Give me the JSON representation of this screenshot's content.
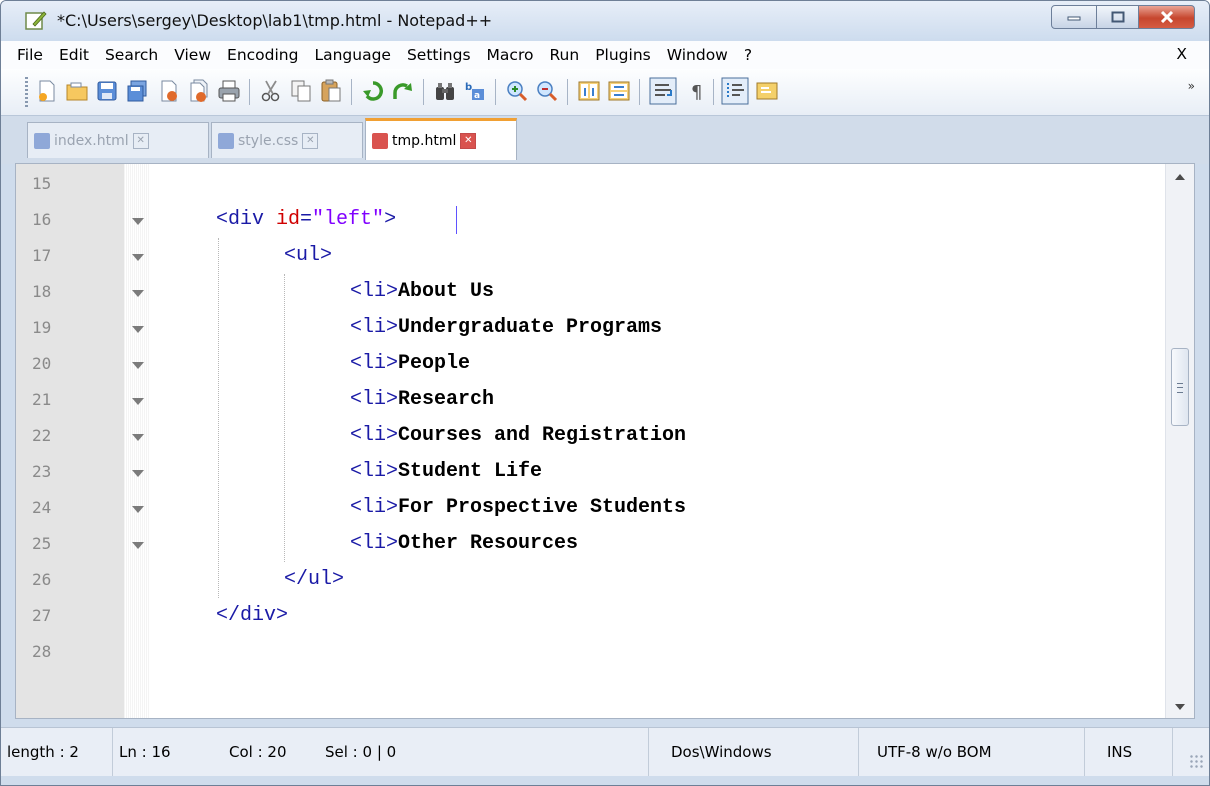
{
  "window": {
    "title": "*C:\\Users\\sergey\\Desktop\\lab1\\tmp.html - Notepad++"
  },
  "menu": {
    "items": [
      "File",
      "Edit",
      "Search",
      "View",
      "Encoding",
      "Language",
      "Settings",
      "Macro",
      "Run",
      "Plugins",
      "Window",
      "?"
    ],
    "close_label": "X"
  },
  "toolbar": {
    "icons": [
      "new-file-icon",
      "open-file-icon",
      "save-icon",
      "save-all-icon",
      "close-icon",
      "close-all-icon",
      "print-icon",
      "cut-icon",
      "copy-icon",
      "paste-icon",
      "undo-icon",
      "redo-icon",
      "find-icon",
      "replace-icon",
      "zoom-in-icon",
      "zoom-out-icon",
      "sync-vertical-icon",
      "sync-horizontal-icon",
      "word-wrap-icon",
      "show-all-chars-icon",
      "indent-guide-icon",
      "doc-map-icon"
    ]
  },
  "tabs": [
    {
      "label": "index.html",
      "active": false,
      "icon_color": "#8fa8d8"
    },
    {
      "label": "style.css",
      "active": false,
      "icon_color": "#8fa8d8"
    },
    {
      "label": "tmp.html",
      "active": true,
      "icon_color": "#d9534f"
    }
  ],
  "editor": {
    "lines": [
      {
        "num": "15",
        "fold": false,
        "indent": 0,
        "tag_open": "",
        "attr": "",
        "eq": "",
        "str": "",
        "tag_close": "",
        "text": ""
      },
      {
        "num": "16",
        "fold": true,
        "indent": 1,
        "tag_open": "<div",
        "attr": " id",
        "eq": "=",
        "str": "\"left\"",
        "tag_close": ">",
        "text": ""
      },
      {
        "num": "17",
        "fold": true,
        "indent": 2,
        "tag_open": "<ul>",
        "attr": "",
        "eq": "",
        "str": "",
        "tag_close": "",
        "text": ""
      },
      {
        "num": "18",
        "fold": true,
        "indent": 3,
        "tag_open": "<li>",
        "attr": "",
        "eq": "",
        "str": "",
        "tag_close": "",
        "text": "About Us"
      },
      {
        "num": "19",
        "fold": true,
        "indent": 3,
        "tag_open": "<li>",
        "attr": "",
        "eq": "",
        "str": "",
        "tag_close": "",
        "text": "Undergraduate Programs"
      },
      {
        "num": "20",
        "fold": true,
        "indent": 3,
        "tag_open": "<li>",
        "attr": "",
        "eq": "",
        "str": "",
        "tag_close": "",
        "text": "People"
      },
      {
        "num": "21",
        "fold": true,
        "indent": 3,
        "tag_open": "<li>",
        "attr": "",
        "eq": "",
        "str": "",
        "tag_close": "",
        "text": "Research"
      },
      {
        "num": "22",
        "fold": true,
        "indent": 3,
        "tag_open": "<li>",
        "attr": "",
        "eq": "",
        "str": "",
        "tag_close": "",
        "text": "Courses and Registration"
      },
      {
        "num": "23",
        "fold": true,
        "indent": 3,
        "tag_open": "<li>",
        "attr": "",
        "eq": "",
        "str": "",
        "tag_close": "",
        "text": "Student Life"
      },
      {
        "num": "24",
        "fold": true,
        "indent": 3,
        "tag_open": "<li>",
        "attr": "",
        "eq": "",
        "str": "",
        "tag_close": "",
        "text": "For Prospective Students"
      },
      {
        "num": "25",
        "fold": true,
        "indent": 3,
        "tag_open": "<li>",
        "attr": "",
        "eq": "",
        "str": "",
        "tag_close": "",
        "text": "Other Resources"
      },
      {
        "num": "26",
        "fold": false,
        "indent": 2,
        "tag_open": "</ul>",
        "attr": "",
        "eq": "",
        "str": "",
        "tag_close": "",
        "text": ""
      },
      {
        "num": "27",
        "fold": false,
        "indent": 1,
        "tag_open": "</div>",
        "attr": "",
        "eq": "",
        "str": "",
        "tag_close": "",
        "text": ""
      },
      {
        "num": "28",
        "fold": false,
        "indent": 0,
        "tag_open": "",
        "attr": "",
        "eq": "",
        "str": "",
        "tag_close": "",
        "text": ""
      }
    ]
  },
  "statusbar": {
    "length": "length : 2",
    "ln": "Ln : 16",
    "col": "Col : 20",
    "sel": "Sel : 0 | 0",
    "eol": "Dos\\Windows",
    "encoding": "UTF-8 w/o BOM",
    "mode": "INS"
  },
  "colors": {
    "tag": "#1a1aa6",
    "attr": "#d00000",
    "string": "#8000ff",
    "active_tab_accent": "#f1a033"
  }
}
